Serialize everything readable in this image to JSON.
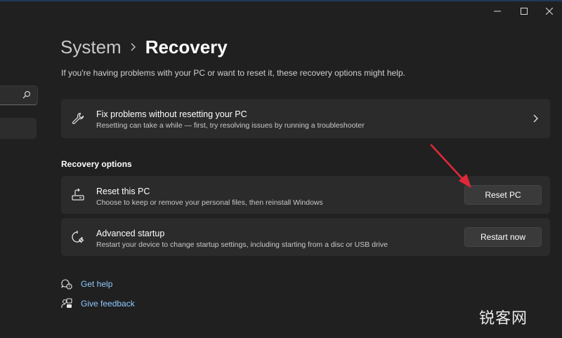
{
  "window_controls": {
    "minimize_icon": "minimize-icon",
    "maximize_icon": "maximize-icon",
    "close_icon": "close-icon"
  },
  "sidebar": {
    "search_icon": "search-icon"
  },
  "breadcrumb": {
    "parent": "System",
    "current": "Recovery"
  },
  "subtitle": "If you're having problems with your PC or want to reset it, these recovery options might help.",
  "fix_card": {
    "title": "Fix problems without resetting your PC",
    "description": "Resetting can take a while — first, try resolving issues by running a troubleshooter",
    "icon": "wrench-icon"
  },
  "recovery_options": {
    "heading": "Recovery options",
    "items": [
      {
        "title": "Reset this PC",
        "description": "Choose to keep or remove your personal files, then reinstall Windows",
        "button": "Reset PC",
        "icon": "reset-pc-icon"
      },
      {
        "title": "Advanced startup",
        "description": "Restart your device to change startup settings, including starting from a disc or USB drive",
        "button": "Restart now",
        "icon": "advanced-startup-icon"
      }
    ]
  },
  "links": {
    "get_help": "Get help",
    "give_feedback": "Give feedback"
  },
  "colors": {
    "background": "#202020",
    "card": "#2b2b2b",
    "link": "#8fc9ff",
    "annotation": "#e0283a"
  },
  "watermark": "锐客网"
}
